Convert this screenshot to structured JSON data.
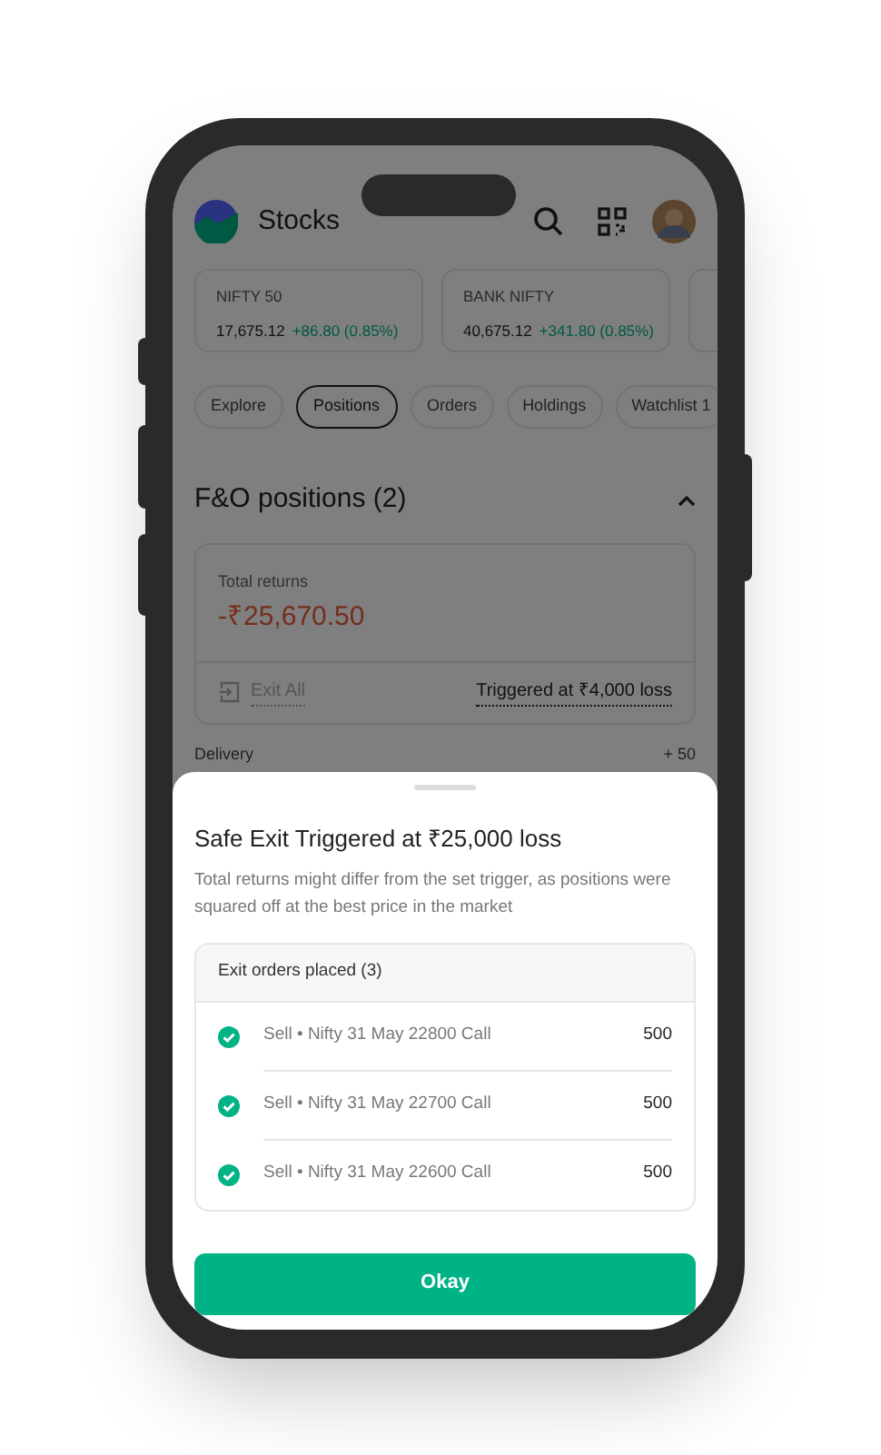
{
  "app_bar": {
    "title": "Stocks"
  },
  "indices": [
    {
      "name": "NIFTY 50",
      "value": "17,675.12",
      "change": "+86.80 (0.85%)"
    },
    {
      "name": "BANK NIFTY",
      "value": "40,675.12",
      "change": "+341.80 (0.85%)"
    }
  ],
  "tabs": [
    {
      "label": "Explore",
      "selected": false
    },
    {
      "label": "Positions",
      "selected": true
    },
    {
      "label": "Orders",
      "selected": false
    },
    {
      "label": "Holdings",
      "selected": false
    },
    {
      "label": "Watchlist 1",
      "selected": false
    }
  ],
  "section": {
    "title": "F&O positions (2)",
    "expanded": true
  },
  "returns_card": {
    "label": "Total returns",
    "value": "-₹25,670.50",
    "exit_button": "Exit All",
    "trigger": "Triggered at ₹4,000 loss"
  },
  "delivery_row": {
    "label": "Delivery",
    "value": "+ 50"
  },
  "sheet": {
    "title": "Safe Exit Triggered at ₹25,000 loss",
    "message": "Total returns might differ from the set trigger, as positions were squared off at the best price in the market",
    "orders_header": "Exit orders placed (3)",
    "orders": [
      {
        "label": "Sell • Nifty 31 May 22800 Call",
        "qty": "500"
      },
      {
        "label": "Sell • Nifty 31 May 22700 Call",
        "qty": "500"
      },
      {
        "label": "Sell • Nifty 31 May 22600 Call",
        "qty": "500"
      }
    ],
    "button": "Okay"
  }
}
